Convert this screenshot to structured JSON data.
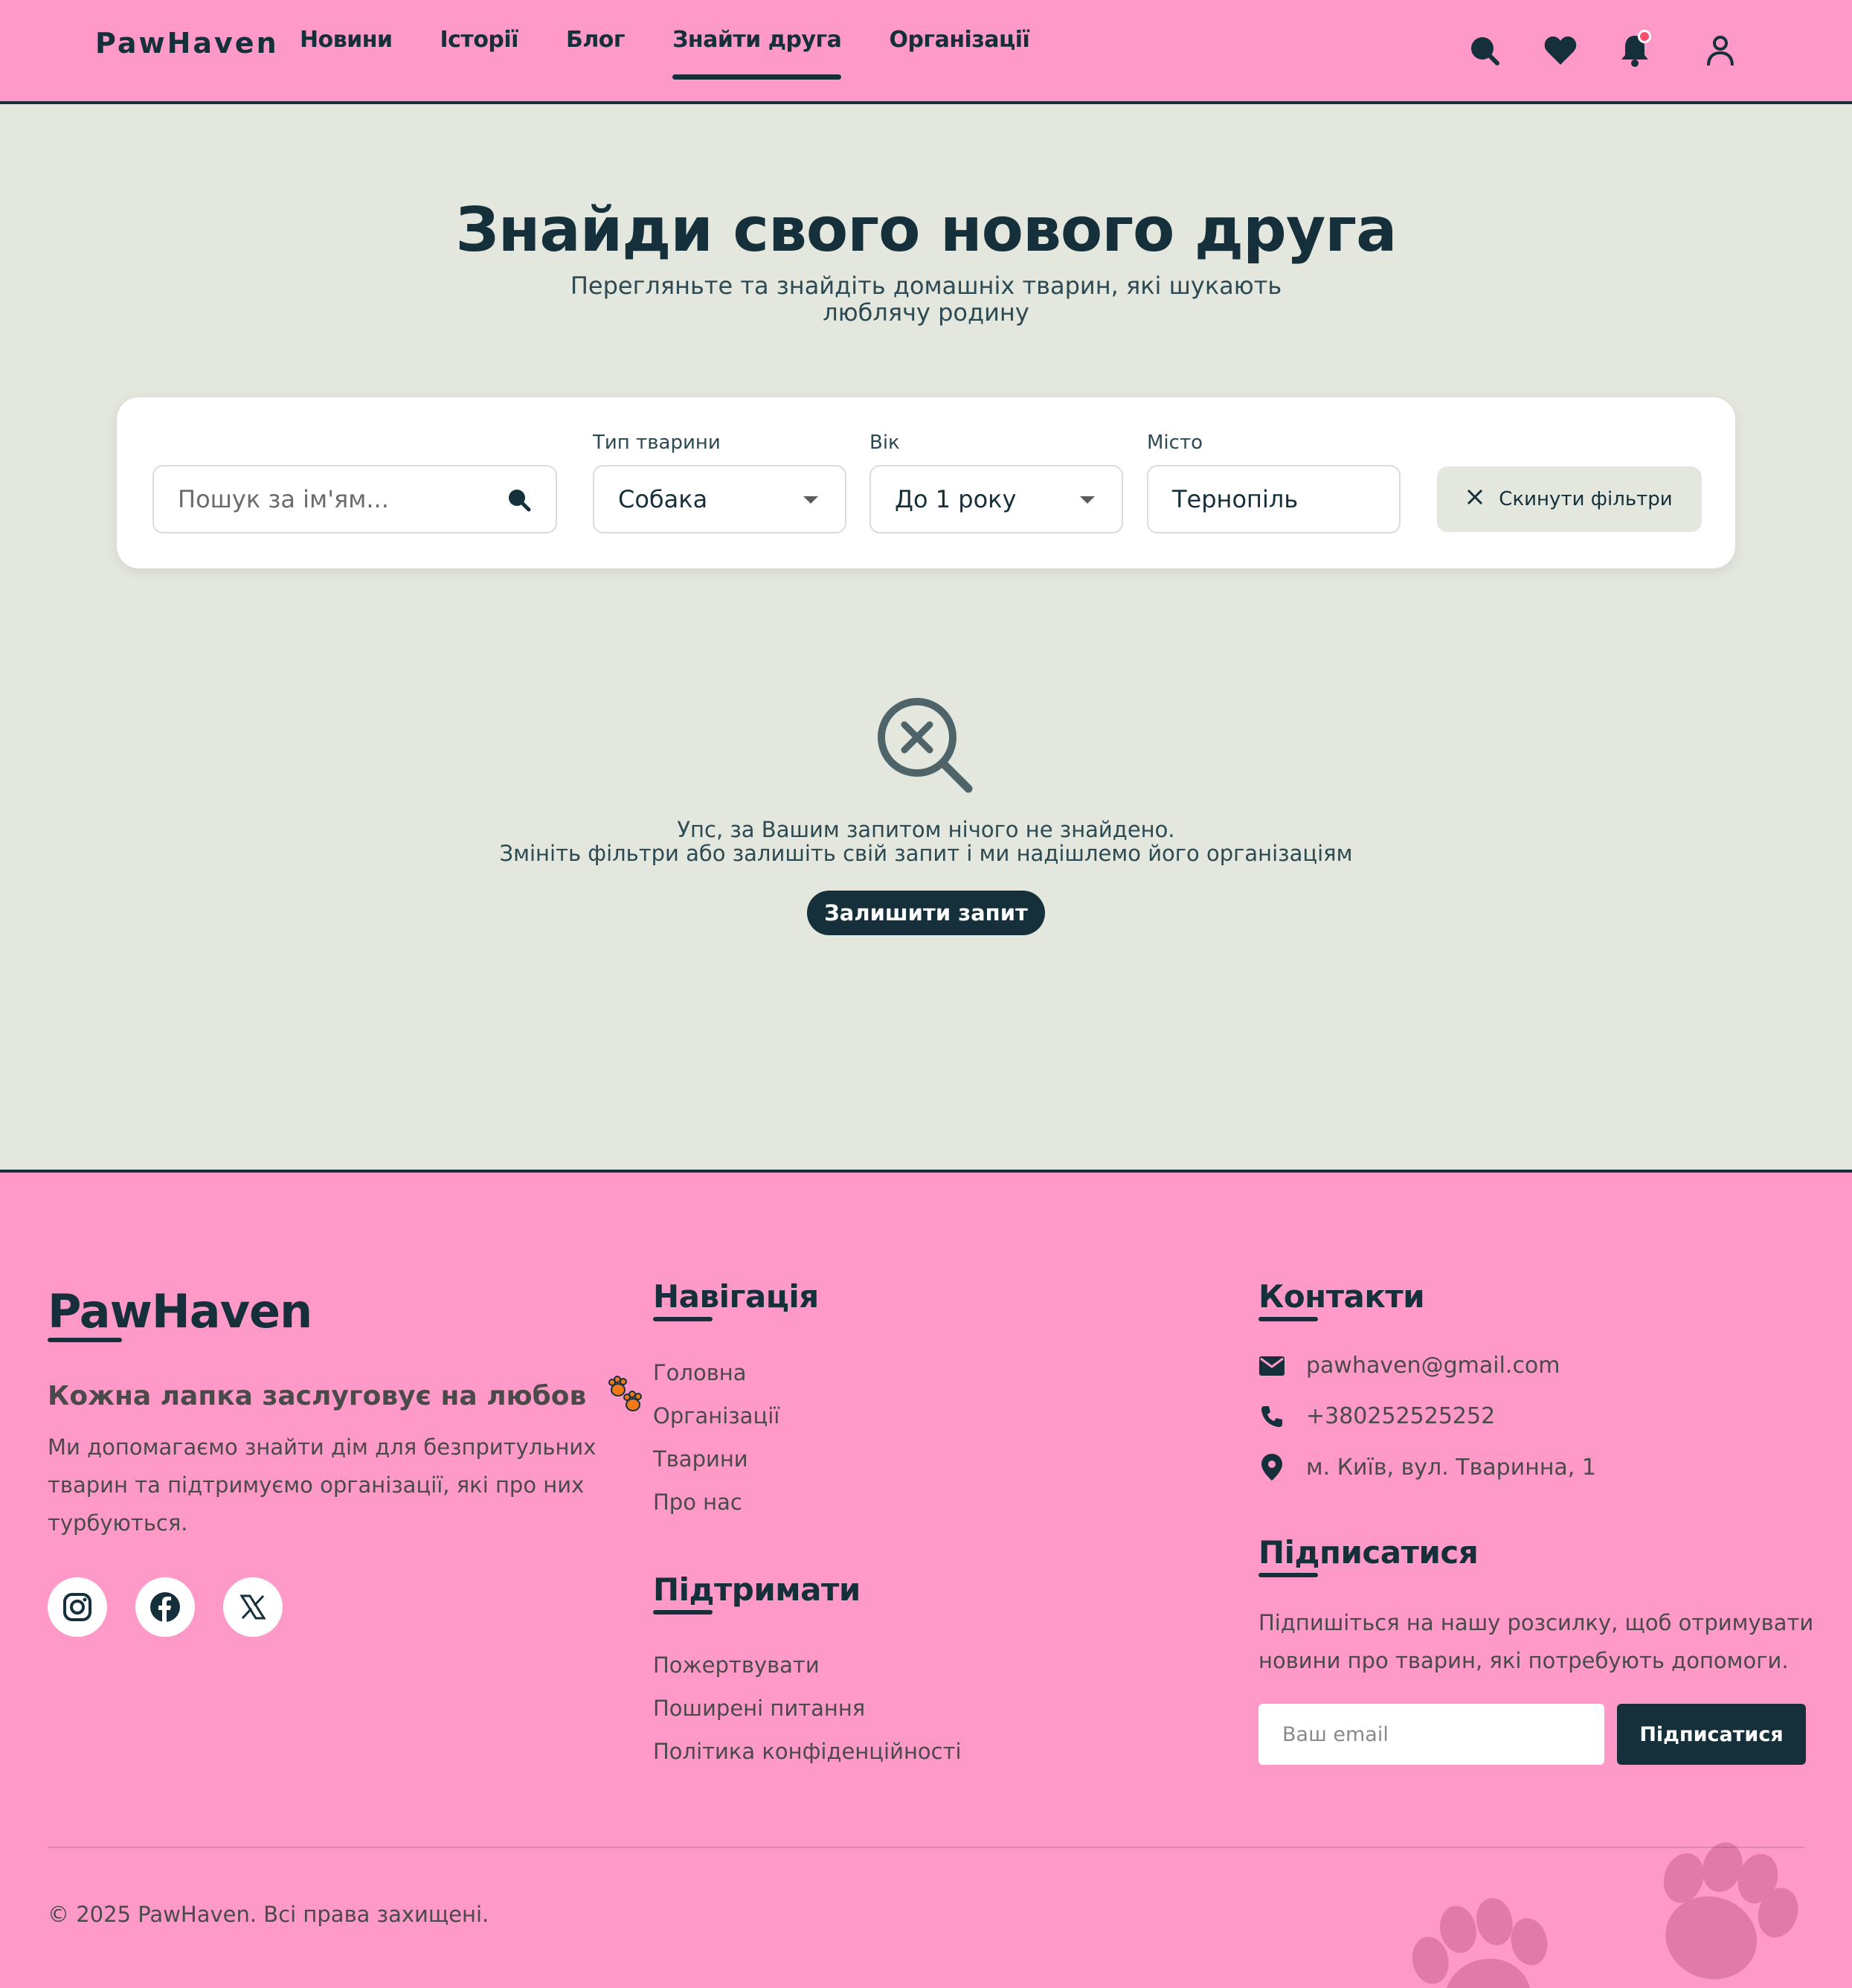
{
  "header": {
    "logo": "PawHaven",
    "nav": [
      "Новини",
      "Історії",
      "Блог",
      "Знайти друга",
      "Організації"
    ],
    "active_nav": "Знайти друга",
    "icons": [
      "search-icon",
      "heart-icon",
      "bell-icon",
      "user-icon"
    ]
  },
  "hero": {
    "title": "Знайди свого нового друга",
    "subtitle": "Перегляньте та знайдіть домашніх тварин, які шукають люблячу родину"
  },
  "filters": {
    "search_placeholder": "Пошук за ім'ям...",
    "type_label": "Тип тварини",
    "type_value": "Собака",
    "age_label": "Вік",
    "age_value": "До 1 року",
    "city_label": "Місто",
    "city_value": "Тернопіль",
    "reset_label": "Скинути фільтри"
  },
  "empty_state": {
    "line1": "Упс, за Вашим запитом нічого не знайдено.",
    "line2": "Змініть фільтри або залишіть свій запит і ми надішлемо його організаціям",
    "button": "Залишити запит"
  },
  "footer": {
    "logo": "PawHaven",
    "tagline": "Кожна лапка заслуговує на любов",
    "description": "Ми допомагаємо знайти дім для безпритульних тварин та підтримуємо організації, які про них турбуються.",
    "social": [
      "instagram-icon",
      "facebook-icon",
      "x-icon"
    ],
    "nav_title": "Навігація",
    "nav_links": [
      "Головна",
      "Організації",
      "Тварини",
      "Про нас"
    ],
    "support_title": "Підтримати",
    "support_links": [
      "Пожертвувати",
      "Поширені питання",
      "Політика конфіденційності"
    ],
    "contacts_title": "Контакти",
    "email": "pawhaven@gmail.com",
    "phone": "+380252525252",
    "address": "м. Київ, вул. Тваринна, 1",
    "subscribe_title": "Підписатися",
    "subscribe_desc": "Підпишіться на нашу розсилку, щоб отримувати новини про тварин, які потребують допомоги.",
    "email_placeholder": "Ваш email",
    "subscribe_button": "Підписатися",
    "copyright": "© 2025 PawHaven. Всі права захищені."
  },
  "colors": {
    "brand_pink": "#ff99c8",
    "dark": "#15303a",
    "page_bg": "#e3e7de",
    "notification": "#ff4d6d"
  }
}
